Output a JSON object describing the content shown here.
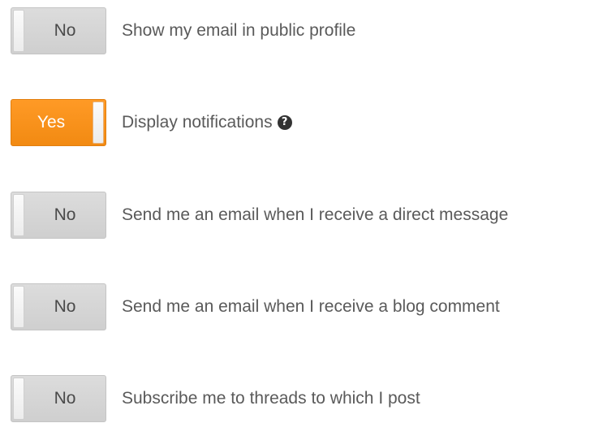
{
  "settings": [
    {
      "toggle_label": "No",
      "toggle_state": "off",
      "label": "Show my email in public profile"
    },
    {
      "toggle_label": "Yes",
      "toggle_state": "on",
      "label": "Display notifications",
      "help_icon": "question-circle-icon",
      "help_symbol": "?"
    },
    {
      "toggle_label": "No",
      "toggle_state": "off",
      "label": "Send me an email when I receive a direct message"
    },
    {
      "toggle_label": "No",
      "toggle_state": "off",
      "label": "Send me an email when I receive a blog comment"
    },
    {
      "toggle_label": "No",
      "toggle_state": "off",
      "label": "Subscribe me to threads to which I post"
    }
  ],
  "colors": {
    "toggle_on": "#f28a12",
    "toggle_off": "#d6d6d6",
    "label_text": "#5a5a5a"
  }
}
